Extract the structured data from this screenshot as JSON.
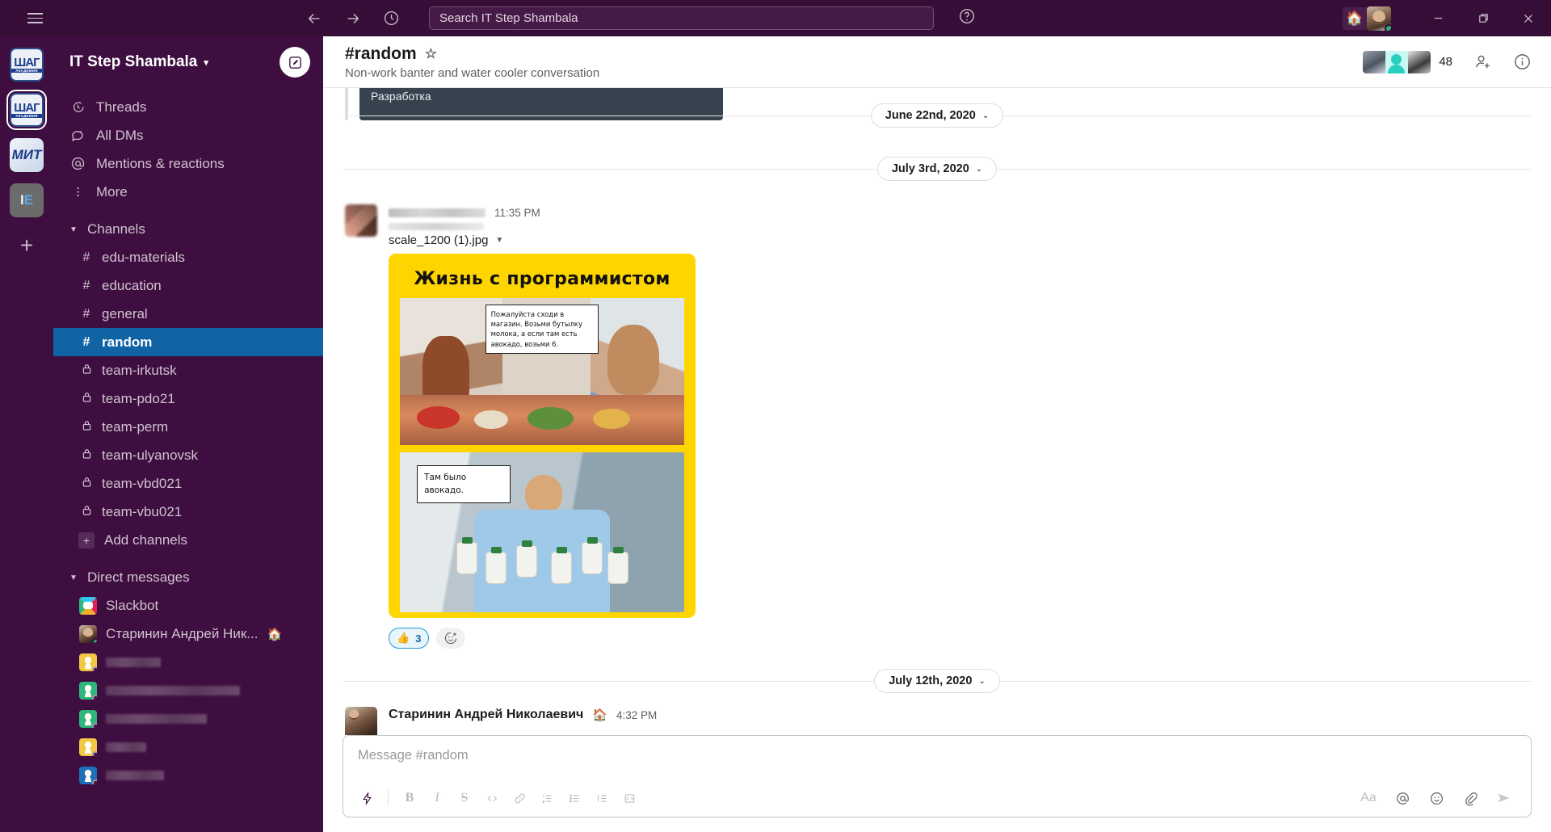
{
  "topbar": {
    "menu_icon": "hamburger-icon",
    "back_icon": "arrow-left-icon",
    "forward_icon": "arrow-right-icon",
    "history_icon": "clock-icon",
    "search_placeholder": "Search IT Step Shambala",
    "help_icon": "question-circle-icon",
    "status_emoji": "🏠",
    "window_minimize": "–",
    "window_maximize": "❐",
    "window_close": "✕"
  },
  "rail": {
    "workspaces": [
      {
        "name": "shag-academy-1",
        "label_top": "ШАГ",
        "label_bottom": "КОМПЬЮТЕРНАЯ АКАДЕМИЯ",
        "active": false
      },
      {
        "name": "shag-academy-2",
        "label_top": "ШАГ",
        "label_bottom": "КОМПЬЮТЕРНАЯ АКАДЕМИЯ",
        "active": true
      },
      {
        "name": "mit-workspace",
        "label_top": "МИТ",
        "active": false
      },
      {
        "name": "ie-workspace",
        "label_i": "I",
        "label_e": "E",
        "active": false
      }
    ],
    "add_label": "+"
  },
  "sidebar": {
    "workspace_name": "IT Step Shambala",
    "workspace_chevron": "⌄",
    "compose_icon": "pencil-compose-icon",
    "nav": [
      {
        "label": "Threads",
        "icon": "threads-icon"
      },
      {
        "label": "All DMs",
        "icon": "all-dms-icon"
      },
      {
        "label": "Mentions & reactions",
        "icon": "at-mention-icon"
      },
      {
        "label": "More",
        "icon": "more-vertical-icon"
      }
    ],
    "channels_section": {
      "label": "Channels",
      "caret": "▼",
      "items": [
        {
          "name": "edu-materials",
          "sym": "#",
          "private": false,
          "selected": false
        },
        {
          "name": "education",
          "sym": "#",
          "private": false,
          "selected": false
        },
        {
          "name": "general",
          "sym": "#",
          "private": false,
          "selected": false
        },
        {
          "name": "random",
          "sym": "#",
          "private": false,
          "selected": true
        },
        {
          "name": "team-irkutsk",
          "sym": "🔒",
          "private": true,
          "selected": false
        },
        {
          "name": "team-pdo21",
          "sym": "🔒",
          "private": true,
          "selected": false
        },
        {
          "name": "team-perm",
          "sym": "🔒",
          "private": true,
          "selected": false
        },
        {
          "name": "team-ulyanovsk",
          "sym": "🔒",
          "private": true,
          "selected": false
        },
        {
          "name": "team-vbd021",
          "sym": "🔒",
          "private": true,
          "selected": false
        },
        {
          "name": "team-vbu021",
          "sym": "🔒",
          "private": true,
          "selected": false
        }
      ],
      "add_channels_label": "Add channels"
    },
    "dm_section": {
      "label": "Direct messages",
      "caret": "▼",
      "items": [
        {
          "name": "Slackbot",
          "redacted": false,
          "avatar": "slackbot",
          "presence": "none",
          "status_emoji": ""
        },
        {
          "name": "Старинин Андрей Ник...",
          "redacted": false,
          "avatar": "andrey",
          "presence": "online",
          "status_emoji": "🏠"
        },
        {
          "name": "",
          "redacted": true,
          "redact_width": 68,
          "avatar": "person-y",
          "presence": "offline",
          "status_emoji": ""
        },
        {
          "name": "",
          "redacted": true,
          "redact_width": 166,
          "avatar": "person-g",
          "presence": "offline",
          "status_emoji": ""
        },
        {
          "name": "",
          "redacted": true,
          "redact_width": 125,
          "avatar": "person-g",
          "presence": "offline",
          "status_emoji": ""
        },
        {
          "name": "",
          "redacted": true,
          "redact_width": 50,
          "avatar": "person-y",
          "presence": "offline",
          "status_emoji": ""
        },
        {
          "name": "",
          "redacted": true,
          "redact_width": 72,
          "avatar": "person-b",
          "presence": "offline",
          "status_emoji": ""
        }
      ]
    }
  },
  "channel_header": {
    "title": "#random",
    "star_icon": "star-outline-icon",
    "topic": "Non-work banter and water cooler conversation",
    "member_count": "48",
    "add_member_icon": "person-plus-icon",
    "info_icon": "info-circle-icon"
  },
  "messages": {
    "link_preview": {
      "text": "Разработка"
    },
    "dividers": {
      "d1": "June 22nd, 2020",
      "d2": "July 3rd, 2020",
      "d3": "July 12th, 2020",
      "chevron": "⌄"
    },
    "image_message": {
      "sender_redacted": true,
      "time": "11:35 PM",
      "file_name": "scale_1200 (1).jpg",
      "file_chevron": "▼",
      "meme": {
        "title": "Жизнь с программистом",
        "bubble_top": "Пожалуйста сходи в магазин. Возьми бутылку молока, а если там есть авокадо, возьми 6.",
        "bubble_bottom": "Там было авокадо."
      },
      "reactions": [
        {
          "emoji": "👍",
          "count": "3",
          "name": "thumbsup-reaction"
        }
      ],
      "add_reaction_icon": "add-reaction-icon"
    },
    "last_message": {
      "sender": "Старинин Андрей Николаевич",
      "status_emoji": "🏠",
      "time": "4:32 PM"
    }
  },
  "composer": {
    "placeholder": "Message #random",
    "toolbar_left": [
      {
        "name": "shortcuts-bolt-icon",
        "glyph": "⚡"
      },
      {
        "name": "bold-icon",
        "glyph": "B"
      },
      {
        "name": "italic-icon",
        "glyph": "I"
      },
      {
        "name": "strikethrough-icon",
        "glyph": "S"
      },
      {
        "name": "code-icon",
        "glyph": "‹›"
      },
      {
        "name": "link-icon",
        "glyph": "🔗"
      },
      {
        "name": "ordered-list-icon",
        "glyph": "1."
      },
      {
        "name": "bulleted-list-icon",
        "glyph": "•"
      },
      {
        "name": "blockquote-icon",
        "glyph": "❝"
      },
      {
        "name": "code-block-icon",
        "glyph": "▣"
      }
    ],
    "toolbar_right": [
      {
        "name": "formatting-aa-icon",
        "glyph": "Aa"
      },
      {
        "name": "mention-icon",
        "glyph": "@"
      },
      {
        "name": "emoji-icon",
        "glyph": "☺"
      },
      {
        "name": "attachment-icon",
        "glyph": "📎"
      },
      {
        "name": "send-icon",
        "glyph": "➤"
      }
    ]
  },
  "colors": {
    "sidebar_bg": "#3F0E40",
    "topbar_bg": "#350D36",
    "selected_channel": "#1164A3",
    "meme_yellow": "#FFD500",
    "reaction_blue": "#1264A3"
  }
}
